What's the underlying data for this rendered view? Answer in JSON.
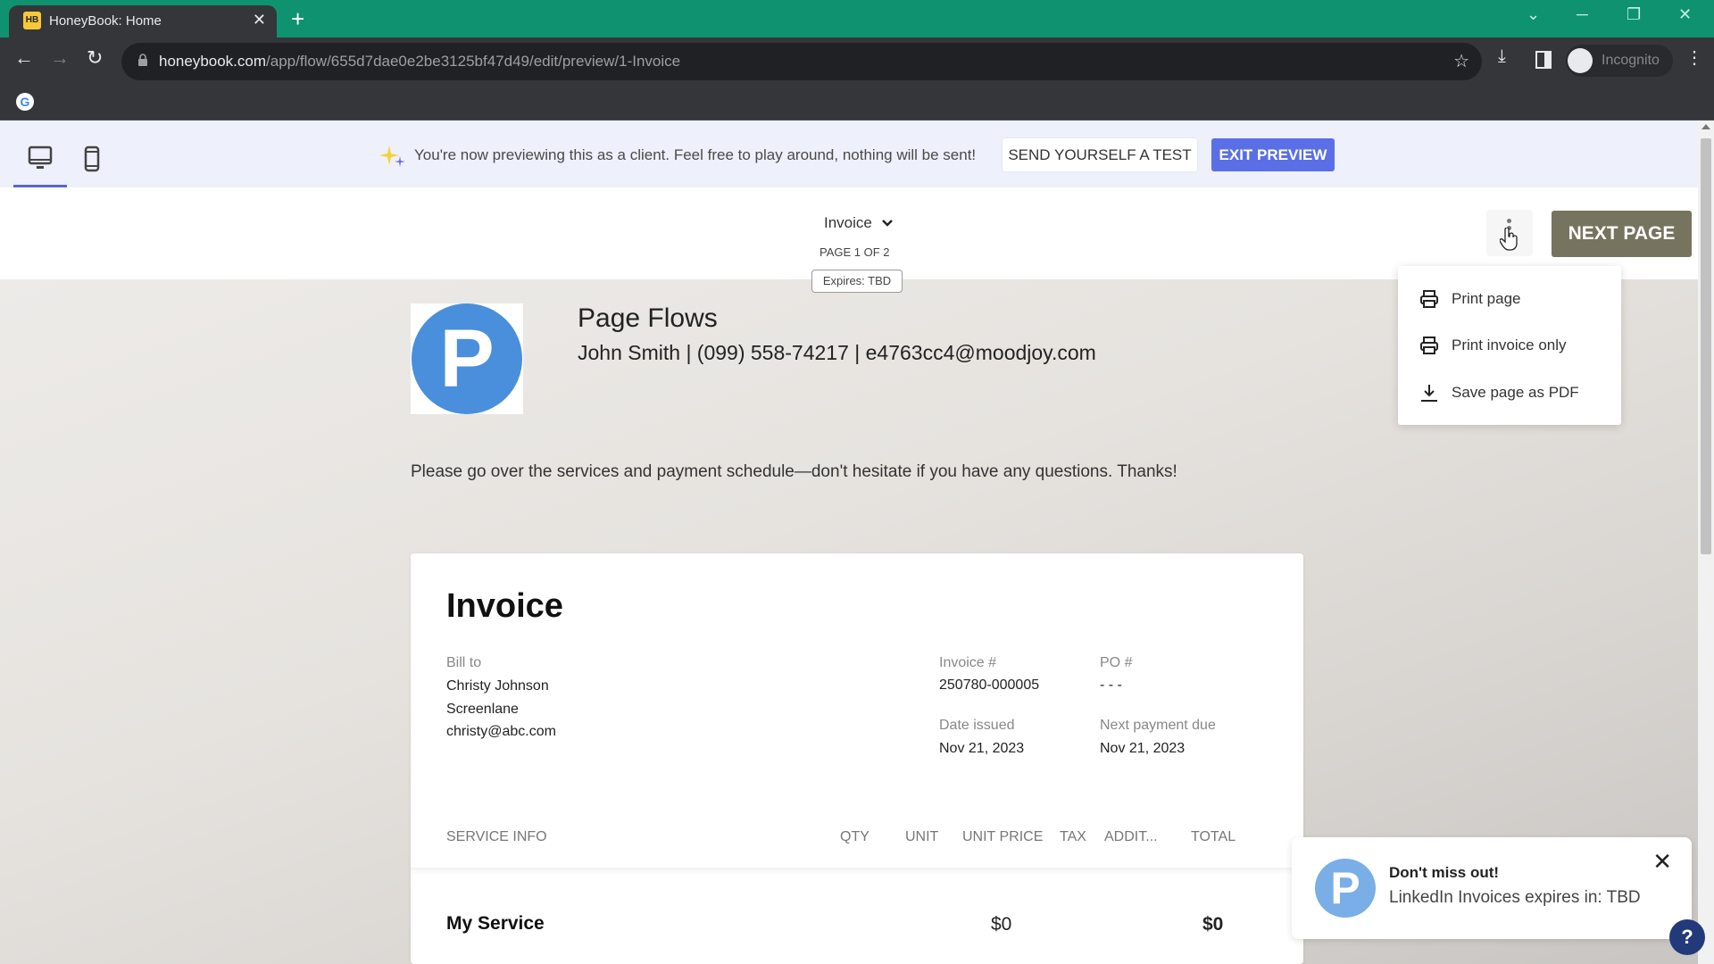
{
  "browser": {
    "tab_title": "HoneyBook: Home",
    "tab_favicon_text": "HB",
    "url_domain": "honeybook.com",
    "url_path": "/app/flow/655d7dae0e2be3125bf47d49/edit/preview/1-Invoice",
    "profile_label": "Incognito",
    "icons": {
      "back": "←",
      "forward": "→",
      "reload": "↻",
      "star": "☆",
      "download": "⤓",
      "menu": "⋮",
      "newtab": "+",
      "close": "✕",
      "minimize": "─",
      "restore": "❐",
      "tablist": "⌄",
      "google": "G"
    }
  },
  "preview_banner": {
    "message": "You're now previewing this as a client. Feel free to play around, nothing will be sent!",
    "send_test_label": "SEND YOURSELF A TEST",
    "exit_preview_label": "EXIT PREVIEW",
    "accent_color": "#5a6fe6"
  },
  "header": {
    "page_selector": "Invoice",
    "page_indicator": "PAGE 1 OF 2",
    "expires_badge": "Expires: TBD",
    "next_page_label": "NEXT PAGE"
  },
  "more_menu": {
    "items": [
      {
        "label": "Print page",
        "icon": "printer-icon"
      },
      {
        "label": "Print invoice only",
        "icon": "printer-icon"
      },
      {
        "label": "Save page as PDF",
        "icon": "download-icon"
      }
    ]
  },
  "business": {
    "logo_letter": "P",
    "name": "Page Flows",
    "contact": "John Smith | (099) 558-74217 | e4763cc4@moodjoy.com",
    "intro_message": "Please go over the services and payment schedule—don't hesitate if you have any questions. Thanks!"
  },
  "invoice": {
    "title": "Invoice",
    "bill_to_label": "Bill to",
    "bill_to_name": "Christy Johnson",
    "bill_to_company": "Screenlane",
    "bill_to_email": "christy@abc.com",
    "invoice_number_label": "Invoice #",
    "invoice_number": "250780-000005",
    "po_label": "PO #",
    "po_value": "- - -",
    "date_issued_label": "Date issued",
    "date_issued": "Nov 21, 2023",
    "next_payment_label": "Next payment due",
    "next_payment": "Nov 21, 2023",
    "columns": [
      "SERVICE INFO",
      "QTY",
      "UNIT",
      "UNIT PRICE",
      "TAX",
      "ADDIT...",
      "TOTAL"
    ],
    "rows": [
      {
        "service": "My Service",
        "qty": "",
        "unit": "",
        "unit_price": "$0",
        "tax": "",
        "additional": "",
        "total": "$0"
      }
    ]
  },
  "toast": {
    "avatar_letter": "P",
    "title": "Don't miss out!",
    "body": "LinkedIn Invoices expires in: TBD"
  },
  "help_label": "?"
}
